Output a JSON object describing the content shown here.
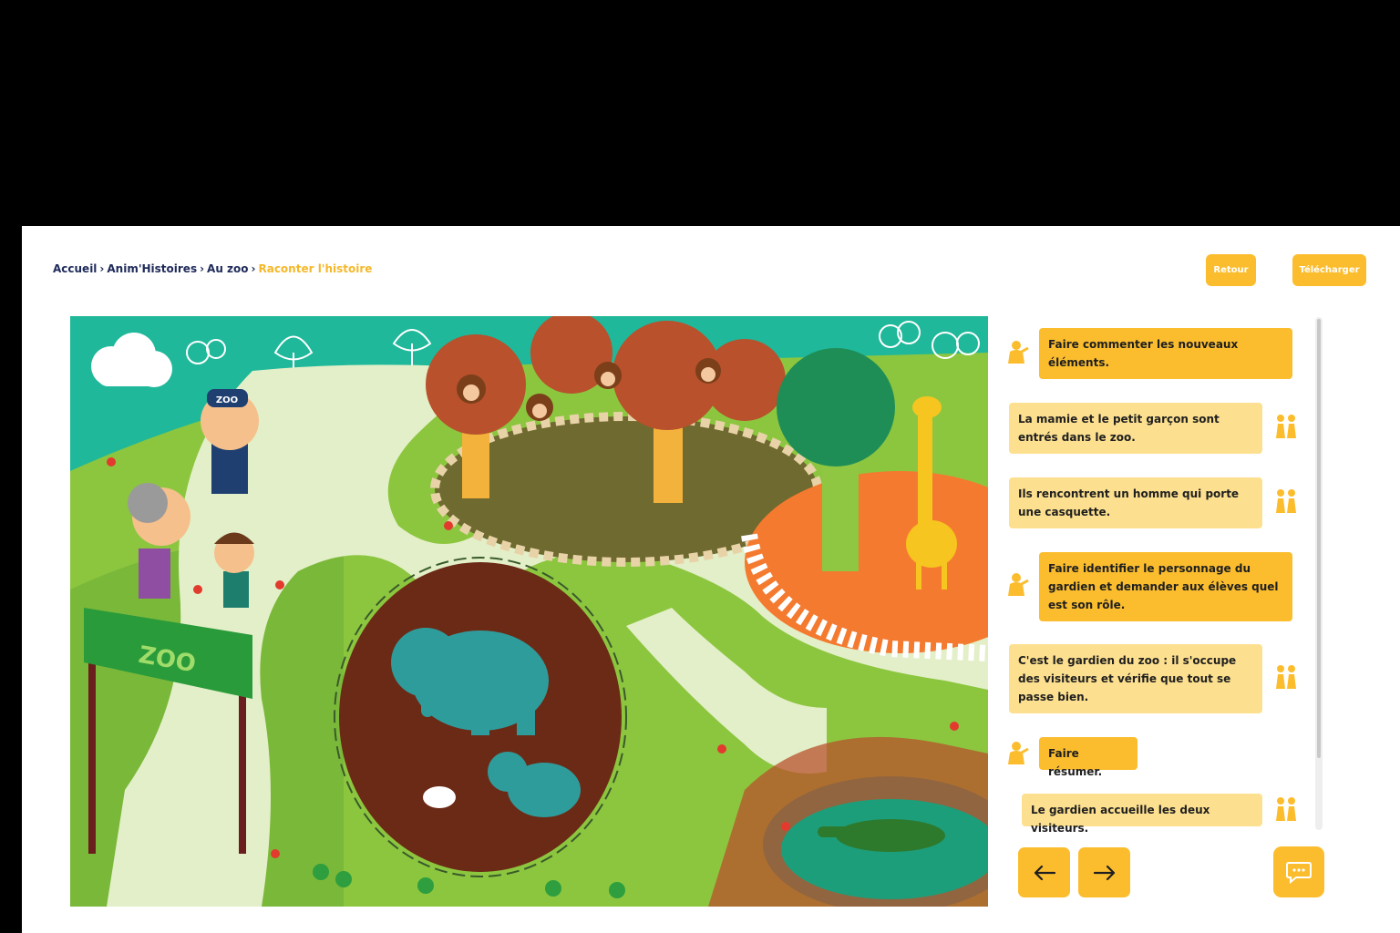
{
  "breadcrumb": {
    "items": [
      "Accueil",
      "Anim'Histoires",
      "Au zoo"
    ],
    "current": "Raconter l'histoire",
    "separator": "›"
  },
  "header": {
    "back_label": "Retour",
    "download_label": "Télécharger"
  },
  "scene": {
    "sign_text": "ZOO",
    "cap_text": "ZOO"
  },
  "dialogue": {
    "lines": [
      {
        "speaker": "teacher",
        "text": "Faire commenter les nouveaux éléments."
      },
      {
        "speaker": "children",
        "text": "La mamie et le petit garçon sont entrés dans le zoo."
      },
      {
        "speaker": "children",
        "text": "Ils rencontrent un homme qui porte une casquette."
      },
      {
        "speaker": "teacher",
        "text": "Faire identifier le personnage du gardien et demander aux élèves quel est son rôle."
      },
      {
        "speaker": "children",
        "text": "C'est le gardien du zoo : il s'occupe des visiteurs et vérifie que tout se passe bien."
      },
      {
        "speaker": "teacher",
        "text": "Faire résumer."
      },
      {
        "speaker": "children",
        "text": "Le gardien accueille les deux visiteurs."
      }
    ]
  },
  "icons": {
    "teacher": "teacher-icon",
    "children": "children-icon",
    "prev": "arrow-left-icon",
    "next": "arrow-right-icon",
    "chat": "chat-icon"
  },
  "colors": {
    "accent": "#fbbd2e",
    "child_bubble": "#fde08f",
    "breadcrumb": "#1e2a5a",
    "breadcrumb_current": "#f5b82a"
  }
}
